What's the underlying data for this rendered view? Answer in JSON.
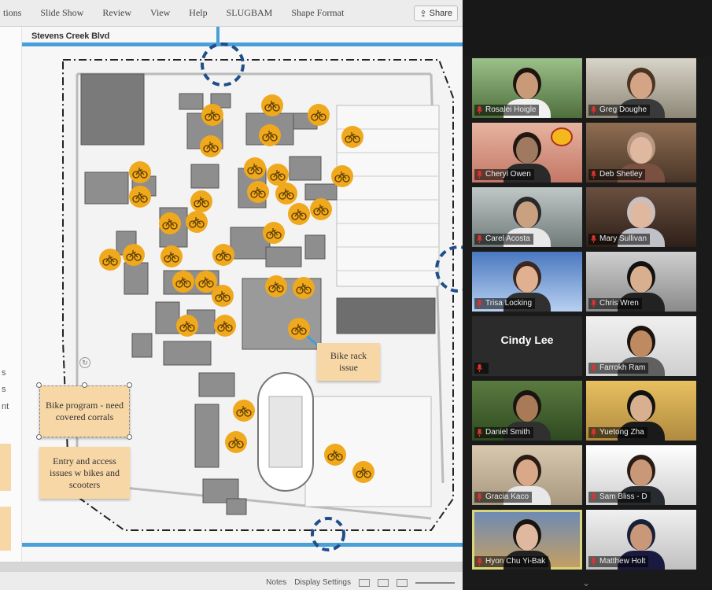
{
  "menubar": {
    "items": [
      "tions",
      "Slide Show",
      "Review",
      "View",
      "Help",
      "SLUGBAM",
      "Shape Format"
    ],
    "share_label": "Share"
  },
  "slide": {
    "street_label": "Stevens Creek Blvd",
    "left_strip_texts": [
      "s",
      "s",
      "nt"
    ],
    "notes": {
      "bike_rack": "Bike rack issue",
      "bike_program": "Bike program - need covered corrals",
      "entry_access": "Entry and access issues w bikes and scooters"
    },
    "bike_marker_color": "#f0a91d",
    "accent_color": "#1f4f8a"
  },
  "bottombar": {
    "notes_label": "Notes",
    "display_settings_label": "Display Settings"
  },
  "gallery": {
    "participants": [
      {
        "name": "Rosalei Hoigle"
      },
      {
        "name": "Greg Doughe"
      },
      {
        "name": "Cheryl Owen"
      },
      {
        "name": "Deb Shetley"
      },
      {
        "name": "Carel Acosta"
      },
      {
        "name": "Mary Sullivan"
      },
      {
        "name": "Trisa Locking"
      },
      {
        "name": "Chris Wren"
      },
      {
        "name": "Cindy Lee"
      },
      {
        "name": "Farrokh Ram"
      },
      {
        "name": "Daniel Smith"
      },
      {
        "name": "Yuetong Zha"
      },
      {
        "name": "Gracia Kaco"
      },
      {
        "name": "Sam Bliss - D"
      },
      {
        "name": "Hyon Chu Yi-Bak"
      },
      {
        "name": "Matthew Holt"
      }
    ],
    "active_color": "#d8d57a"
  }
}
